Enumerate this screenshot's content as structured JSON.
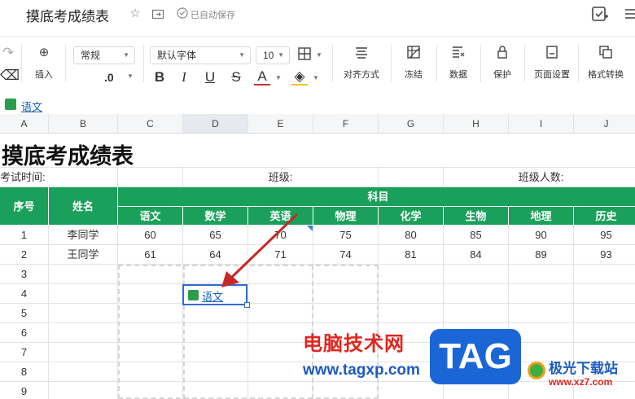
{
  "title_bar": {
    "doc_title": "摸底考成绩表",
    "saved_status": "已自动保存"
  },
  "toolbar": {
    "insert_label": "插入",
    "number_format": "常规",
    "font_family": "默认字体",
    "font_size": "10",
    "decimal_label": ".0",
    "align_label": "对齐方式",
    "freeze_label": "冻结",
    "data_label": "数据",
    "protect_label": "保护",
    "page_setup_label": "页面设置",
    "format_convert_label": "格式转换",
    "bold": "B",
    "italic": "I",
    "underline": "U",
    "strike": "S",
    "font_color": "A"
  },
  "name_bar": {
    "link_text": "语文"
  },
  "columns": [
    "A",
    "B",
    "C",
    "D",
    "E",
    "F",
    "G",
    "H",
    "I",
    "J"
  ],
  "sheet": {
    "title": "摸底考成绩表",
    "exam_time_label": "考试时间:",
    "class_label": "班级:",
    "class_size_label": "班级人数:",
    "header_index": "序号",
    "header_name": "姓名",
    "header_subjects": "科目",
    "subjects": [
      "语文",
      "数学",
      "英语",
      "物理",
      "化学",
      "生物",
      "地理",
      "历史"
    ],
    "students": [
      {
        "index": "1",
        "name": "李同学",
        "scores": [
          "60",
          "65",
          "70",
          "75",
          "80",
          "85",
          "90",
          "95"
        ]
      },
      {
        "index": "2",
        "name": "王同学",
        "scores": [
          "61",
          "64",
          "71",
          "74",
          "81",
          "84",
          "89",
          "93"
        ]
      }
    ],
    "empty_rows": [
      "3",
      "4",
      "5",
      "6",
      "7",
      "8",
      "9"
    ],
    "selected_cell_link": "语文"
  },
  "watermark": {
    "cn_text": "电脑技术网",
    "url_text": "www.tagxp.com",
    "tag_text": "TAG",
    "site_name": "极光下载站",
    "site_url": "www.xz7.com"
  },
  "colors": {
    "header_green": "#1aa05a",
    "link_blue": "#1a5fb4",
    "selection_blue": "#2f6bd0",
    "arrow_red": "#c62828"
  }
}
